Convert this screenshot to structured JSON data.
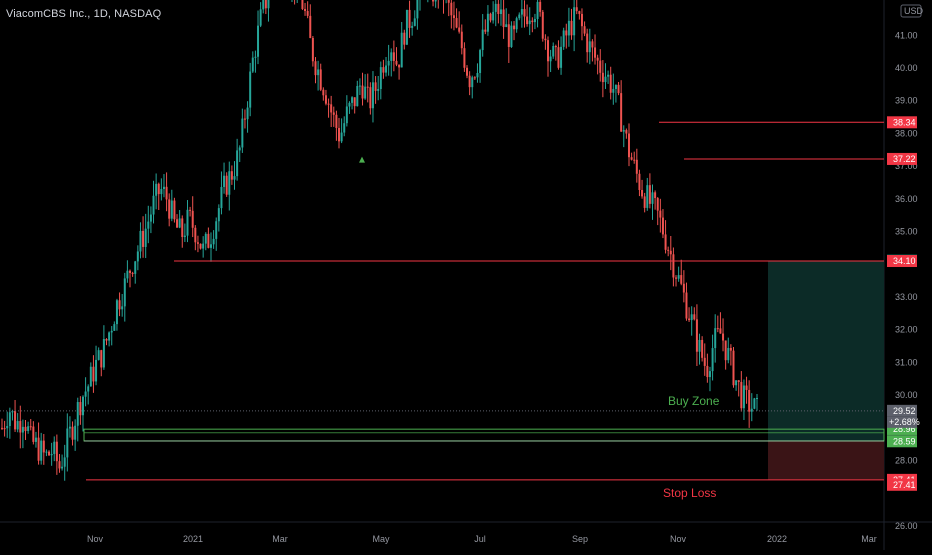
{
  "header": {
    "title": "ViacomCBS Inc., 1D, NASDAQ",
    "currency": "USD"
  },
  "colors": {
    "background": "#000000",
    "up": "#26a69a",
    "down": "#ef5350",
    "level_line": "#f23645",
    "buy_zone": "#4caf50",
    "tag_red": "#f23645",
    "tag_green": "#4caf50",
    "tag_teal": "#089981",
    "tag_gray": "#5d606b",
    "target_fill": "#0c2b27",
    "stop_fill": "#3a1416",
    "marker": "#4caf50",
    "axis_text": "#9598a1"
  },
  "chart_data": {
    "type": "candlestick",
    "title": "ViacomCBS Inc., 1D, NASDAQ",
    "x_ticks": [
      "Nov",
      "2021",
      "Mar",
      "May",
      "Jul",
      "Sep",
      "Nov",
      "2022",
      "Mar"
    ],
    "y_ticks": [
      "26.00",
      "28.00",
      "29.00",
      "30.00",
      "31.00",
      "32.00",
      "33.00",
      "35.00",
      "36.00",
      "37.00",
      "38.00",
      "39.00",
      "40.00",
      "41.00"
    ],
    "ylim": [
      26.0,
      42.1
    ],
    "price_series": [
      29.0,
      29.6,
      29.1,
      29.4,
      28.6,
      28.4,
      28.1,
      28.3,
      27.8,
      28.5,
      29.2,
      29.9,
      30.3,
      30.9,
      31.3,
      32.0,
      32.8,
      33.3,
      34.0,
      34.5,
      35.1,
      35.8,
      36.3,
      36.0,
      35.2,
      34.9,
      35.4,
      35.0,
      34.4,
      34.9,
      35.6,
      36.4,
      36.8,
      37.4,
      38.9,
      40.4,
      41.5,
      42.3,
      43.0,
      43.5,
      42.8,
      42.6,
      41.8,
      40.6,
      39.9,
      39.3,
      38.5,
      37.9,
      38.6,
      39.0,
      39.6,
      38.9,
      39.4,
      40.2,
      40.8,
      40.1,
      41.2,
      41.6,
      42.3,
      42.8,
      42.3,
      42.6,
      41.9,
      41.2,
      40.6,
      39.7,
      40.1,
      41.0,
      41.5,
      41.8,
      41.2,
      40.8,
      41.4,
      41.7,
      41.9,
      41.4,
      40.6,
      40.2,
      40.7,
      41.3,
      41.6,
      41.0,
      40.5,
      40.1,
      39.8,
      39.4,
      38.6,
      37.6,
      36.9,
      36.3,
      35.9,
      35.6,
      35.0,
      34.3,
      33.6,
      32.9,
      32.2,
      31.4,
      30.8,
      31.6,
      31.9,
      31.2,
      30.5,
      29.9,
      29.7,
      29.52
    ],
    "last_price": "29.52",
    "change_percent": "+2.68%",
    "levels": [
      {
        "price": 38.34,
        "label": "38.34",
        "role": "resistance"
      },
      {
        "price": 37.22,
        "label": "37.22",
        "role": "resistance"
      },
      {
        "price": 34.1,
        "label": "34.10",
        "role": "resistance"
      },
      {
        "price": 27.41,
        "label": "27.41",
        "role": "stop"
      }
    ],
    "buy_zone": {
      "upper": 28.96,
      "lower": 28.6,
      "label": "Buy Zone"
    },
    "stop_loss": {
      "price": 27.41,
      "label": "Stop Loss"
    },
    "target_price": 34.11,
    "entry_price": 28.59,
    "marker_price": 37.2,
    "price_tags": [
      {
        "label": "38.34",
        "value": 38.34,
        "style": "red"
      },
      {
        "label": "37.22",
        "value": 37.22,
        "style": "red"
      },
      {
        "label": "34.11",
        "value": 34.11,
        "style": "teal"
      },
      {
        "label": "34.10",
        "value": 34.1,
        "style": "red"
      },
      {
        "label": "29.52",
        "value": 29.52,
        "style": "gray"
      },
      {
        "label": "28.96",
        "value": 28.96,
        "style": "green"
      },
      {
        "label": "28.60",
        "value": 28.6,
        "style": "dark"
      },
      {
        "label": "28.59",
        "value": 28.59,
        "style": "green"
      },
      {
        "label": "27.41",
        "value": 27.41,
        "style": "red"
      },
      {
        "label": "27.41",
        "value": 27.26,
        "style": "red"
      }
    ]
  }
}
